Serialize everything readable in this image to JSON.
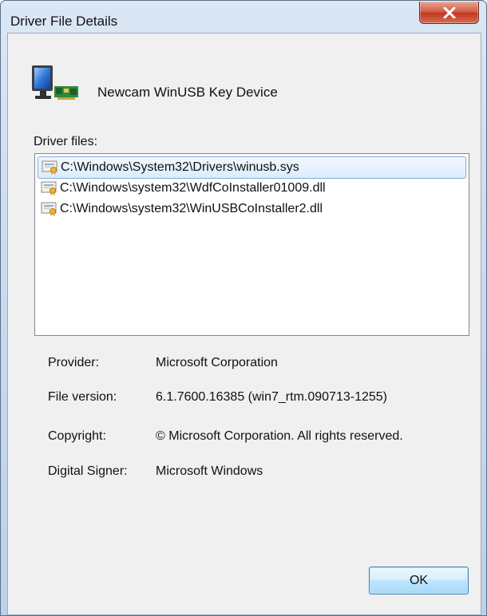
{
  "window": {
    "title": "Driver File Details",
    "close_icon": "close-icon"
  },
  "device": {
    "icon": "computer-monitor-icon",
    "name": "Newcam WinUSB Key Device"
  },
  "files": {
    "label": "Driver files:",
    "items": [
      {
        "path": "C:\\Windows\\System32\\Drivers\\winusb.sys",
        "selected": true,
        "icon": "certificate-icon"
      },
      {
        "path": "C:\\Windows\\system32\\WdfCoInstaller01009.dll",
        "selected": false,
        "icon": "certificate-icon"
      },
      {
        "path": "C:\\Windows\\system32\\WinUSBCoInstaller2.dll",
        "selected": false,
        "icon": "certificate-icon"
      }
    ]
  },
  "details": [
    {
      "label": "Provider:",
      "value": "Microsoft Corporation"
    },
    {
      "label": "File version:",
      "value": "6.1.7600.16385 (win7_rtm.090713-1255)"
    },
    {
      "label": "Copyright:",
      "value": "© Microsoft Corporation. All rights reserved."
    },
    {
      "label": "Digital Signer:",
      "value": "Microsoft Windows"
    }
  ],
  "buttons": {
    "ok_label": "OK"
  },
  "colors": {
    "selection_border": "#84acdd",
    "close_button": "#c2381f",
    "ok_border": "#3c7fb1"
  }
}
